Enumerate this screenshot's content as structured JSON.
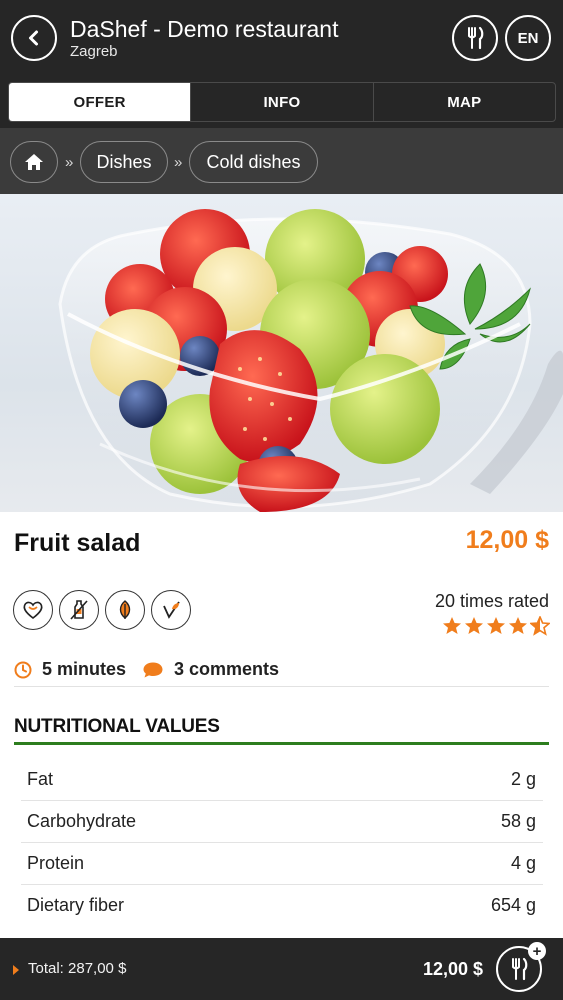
{
  "header": {
    "back_icon": "chevron-left-icon",
    "title": "DaShef - Demo restaurant",
    "subtitle": "Zagreb",
    "menu_icon": "fork-knife-icon",
    "language": "EN"
  },
  "tabs": [
    {
      "label": "OFFER",
      "active": true
    },
    {
      "label": "INFO",
      "active": false
    },
    {
      "label": "MAP",
      "active": false
    }
  ],
  "breadcrumb": {
    "home_icon": "home-icon",
    "separator": "»",
    "items": [
      "Dishes",
      "Cold dishes"
    ]
  },
  "dish": {
    "name": "Fruit salad",
    "price": "12,00 $",
    "badge_icons": [
      "heart-icon",
      "no-bottle-icon",
      "leaf-icon",
      "vegan-icon"
    ],
    "rated_text": "20 times rated",
    "rating": 4.5,
    "rating_max": 5,
    "star_color": "#f07d1c",
    "time": "5 minutes",
    "comments": "3 comments"
  },
  "nutrition": {
    "title": "NUTRITIONAL VALUES",
    "rows": [
      {
        "label": "Fat",
        "value": "2 g"
      },
      {
        "label": "Carbohydrate",
        "value": "58 g"
      },
      {
        "label": "Protein",
        "value": "4 g"
      },
      {
        "label": "Dietary fiber",
        "value": "654 g"
      }
    ]
  },
  "footer": {
    "total": "Total: 287,00 $",
    "price": "12,00 $",
    "cart_icon": "fork-knife-plus-icon"
  },
  "colors": {
    "accent": "#f07d1c",
    "header_bg": "#262626",
    "breadcrumb_bg": "#3b3b3b",
    "nutrition_line": "#2d7d1e"
  }
}
